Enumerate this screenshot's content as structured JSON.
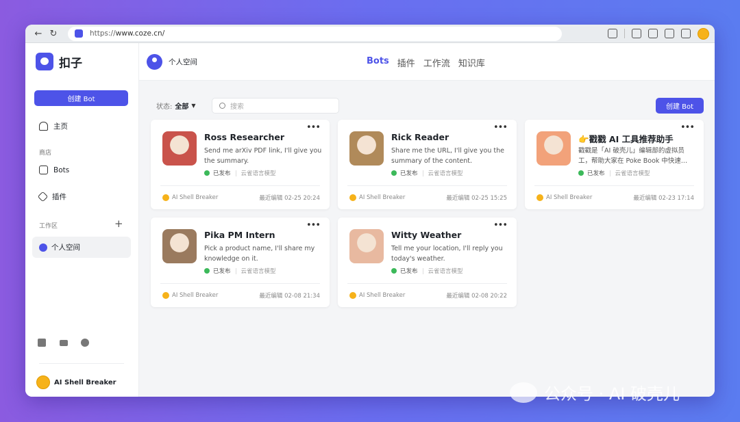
{
  "browser": {
    "url_proto": "https://",
    "url_host": "www.coze.cn/"
  },
  "sidebar": {
    "logo": "扣子",
    "create_label": "创建 Bot",
    "home": "主页",
    "store_section": "商店",
    "bots": "Bots",
    "plugins": "插件",
    "workspace_section": "工作区",
    "personal_space": "个人空间",
    "user": "AI Shell Breaker"
  },
  "header": {
    "workspace": "个人空间",
    "tabs": [
      "Bots",
      "插件",
      "工作流",
      "知识库"
    ],
    "active_tab": "Bots"
  },
  "toolbar": {
    "status_label": "状态:",
    "status_value": "全部",
    "search_placeholder": "搜索",
    "create_label": "创建 Bot"
  },
  "cards": [
    {
      "name": "Ross Researcher",
      "desc": "Send me arXiv PDF link, I'll give you the summary.",
      "status": "已发布",
      "model": "云雀语言模型",
      "author": "AI Shell Breaker",
      "edited": "最近编辑 02-25 20:24",
      "color": "#c9534b"
    },
    {
      "name": "Rick Reader",
      "desc": "Share me the URL, I'll give you the summary of the content.",
      "status": "已发布",
      "model": "云雀语言模型",
      "author": "AI Shell Breaker",
      "edited": "最近编辑 02-25 15:25",
      "color": "#b08a5a"
    },
    {
      "name": "👉戳戳 AI 工具推荐助手",
      "desc": "戳戳是「AI 破壳儿」编辑部的虚拟员工，帮助大家在 Poke Book 中快速...",
      "status": "已发布",
      "model": "云雀语言模型",
      "author": "AI Shell Breaker",
      "edited": "最近编辑 02-23 17:14",
      "color": "#f2a27a"
    },
    {
      "name": "Pika PM Intern",
      "desc": "Pick a product name, I'll share my knowledge on it.",
      "status": "已发布",
      "model": "云雀语言模型",
      "author": "AI Shell Breaker",
      "edited": "最近编辑 02-08 21:34",
      "color": "#9a7a5e"
    },
    {
      "name": "Witty Weather",
      "desc": "Tell me your location, I'll reply you today's weather.",
      "status": "已发布",
      "model": "云雀语言模型",
      "author": "AI Shell Breaker",
      "edited": "最近编辑 02-08 20:22",
      "color": "#e8b9a0"
    }
  ],
  "watermark": "公众号 · AI 破壳儿"
}
